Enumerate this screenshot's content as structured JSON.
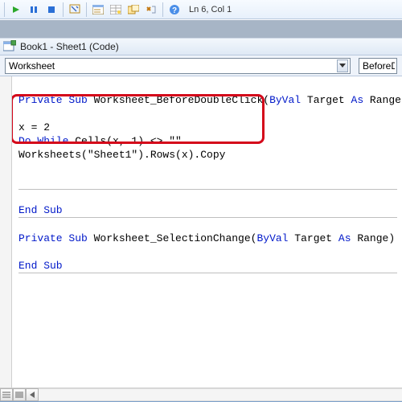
{
  "toolbar": {
    "cursor_position": "Ln 6, Col 1"
  },
  "window": {
    "title": "Book1 - Sheet1 (Code)"
  },
  "dropdowns": {
    "object": "Worksheet",
    "procedure": "BeforeDo"
  },
  "code": {
    "line1_kw1": "Private Sub",
    "line1_fn": " Worksheet_BeforeDoubleClick(",
    "line1_kw2": "ByVal",
    "line1_t1": " Target ",
    "line1_kw3": "As",
    "line1_t2": " Range,",
    "blank": "",
    "line3": "x = 2",
    "line4_kw": "Do While",
    "line4_rest": " Cells(x, 1) <> \"\"",
    "line5": "Worksheets(\"Sheet1\").Rows(x).Copy",
    "end_sub": "End Sub",
    "sel1_kw1": "Private Sub",
    "sel1_fn": " Worksheet_SelectionChange(",
    "sel1_kw2": "ByVal",
    "sel1_t1": " Target ",
    "sel1_kw3": "As",
    "sel1_t2": " Range)"
  }
}
